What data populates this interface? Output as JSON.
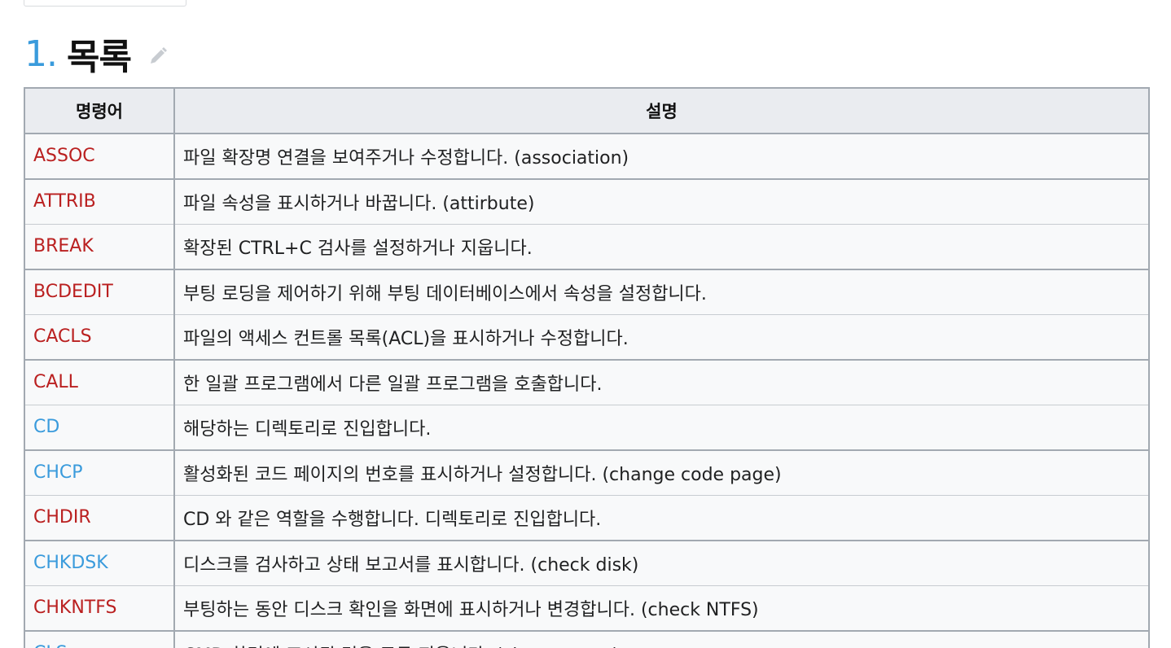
{
  "section": {
    "number": "1.",
    "title": "목록"
  },
  "table": {
    "headers": [
      "명령어",
      "설명"
    ],
    "rows": [
      {
        "cmd": "ASSOC",
        "desc": "파일 확장명 연결을 보여주거나 수정합니다. (association)",
        "link_color": "red"
      },
      {
        "cmd": "ATTRIB",
        "desc": "파일 속성을 표시하거나 바꿉니다. (attirbute)",
        "link_color": "red"
      },
      {
        "cmd": "BREAK",
        "desc": "확장된 CTRL+C 검사를 설정하거나 지웁니다.",
        "link_color": "red"
      },
      {
        "cmd": "BCDEDIT",
        "desc": "부팅 로딩을 제어하기 위해 부팅 데이터베이스에서 속성을 설정합니다.",
        "link_color": "red"
      },
      {
        "cmd": "CACLS",
        "desc": "파일의 액세스 컨트롤 목록(ACL)을 표시하거나 수정합니다.",
        "link_color": "red"
      },
      {
        "cmd": "CALL",
        "desc": "한 일괄 프로그램에서 다른 일괄 프로그램을 호출합니다.",
        "link_color": "red"
      },
      {
        "cmd": "CD",
        "desc": "해당하는 디렉토리로 진입합니다.",
        "link_color": "blue"
      },
      {
        "cmd": "CHCP",
        "desc": "활성화된 코드 페이지의 번호를 표시하거나 설정합니다. (change code page)",
        "link_color": "blue"
      },
      {
        "cmd": "CHDIR",
        "desc": "CD 와 같은 역할을 수행합니다. 디렉토리로 진입합니다.",
        "link_color": "red"
      },
      {
        "cmd": "CHKDSK",
        "desc": "디스크를 검사하고 상태 보고서를 표시합니다. (check disk)",
        "link_color": "blue"
      },
      {
        "cmd": "CHKNTFS",
        "desc": "부팅하는 동안 디스크 확인을 화면에 표시하거나 변경합니다. (check NTFS)",
        "link_color": "red"
      },
      {
        "cmd": "CLS",
        "desc": "CMD 화면에 표시된 것을 모두 지웁니다. (clear screen)",
        "link_color": "blue"
      }
    ]
  },
  "colors": {
    "section_number": "#3a9bdc",
    "link_red": "#ba2020",
    "link_blue": "#3a9bdc",
    "header_bg": "#eaecf0",
    "cell_bg": "#f8f9fa"
  },
  "icons": {
    "edit": "pencil-icon"
  }
}
